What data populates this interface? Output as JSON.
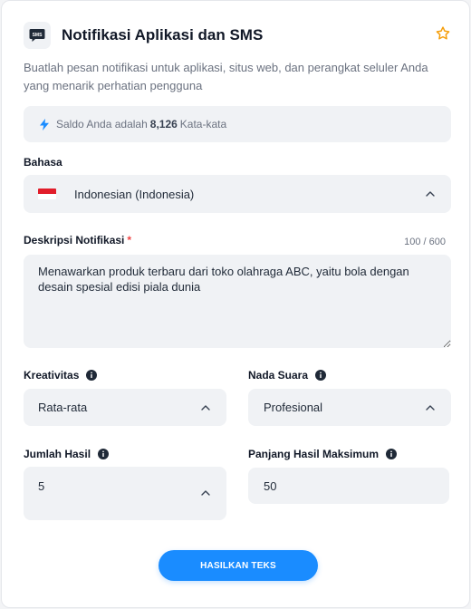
{
  "header": {
    "icon_text": "SMS",
    "title": "Notifikasi Aplikasi dan SMS",
    "subtitle": "Buatlah pesan notifikasi untuk aplikasi, situs web, dan perangkat seluler Anda yang menarik perhatian pengguna"
  },
  "balance": {
    "prefix": "Saldo Anda adalah",
    "amount": "8,126",
    "suffix": "Kata-kata"
  },
  "language": {
    "label": "Bahasa",
    "value": "Indonesian (Indonesia)"
  },
  "description": {
    "label": "Deskripsi Notifikasi",
    "required_mark": "*",
    "counter": "100 / 600",
    "value": "Menawarkan produk terbaru dari toko olahraga ABC, yaitu bola dengan desain spesial edisi piala dunia"
  },
  "creativity": {
    "label": "Kreativitas",
    "value": "Rata-rata"
  },
  "tone": {
    "label": "Nada Suara",
    "value": "Profesional"
  },
  "result_count": {
    "label": "Jumlah Hasil",
    "value": "5"
  },
  "max_length": {
    "label": "Panjang Hasil Maksimum",
    "value": "50"
  },
  "generate_button": {
    "label": "HASILKAN TEKS"
  },
  "colors": {
    "accent": "#1a8cff",
    "field_bg": "#f0f2f5",
    "star": "#f59e0b",
    "required": "#ef4444"
  },
  "icons": [
    "sms-app-icon",
    "star-icon",
    "lightning-icon",
    "indonesia-flag-icon",
    "chevron-up-icon",
    "info-icon"
  ]
}
